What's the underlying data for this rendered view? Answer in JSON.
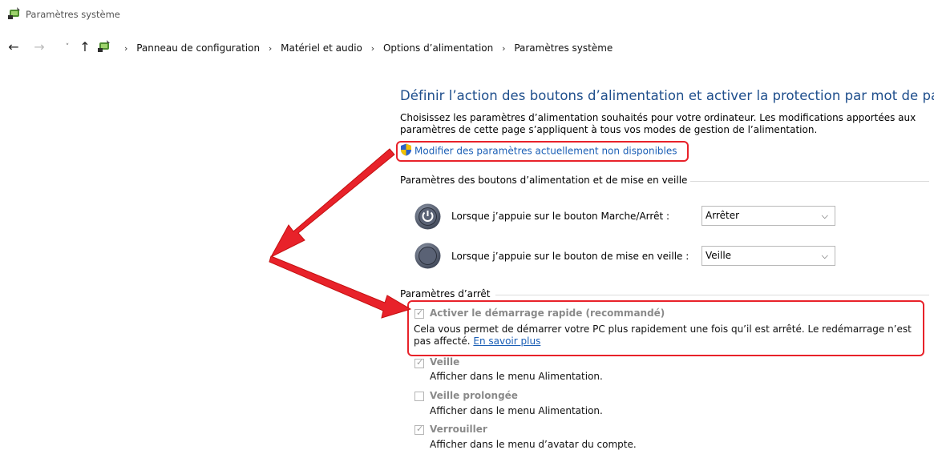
{
  "window": {
    "title": "Paramètres système",
    "icon": "power-options-icon"
  },
  "nav": {
    "back": "←",
    "forward": "→",
    "recent": "˅",
    "up": "↑",
    "breadcrumb": [
      "Panneau de configuration",
      "Matériel et audio",
      "Options d’alimentation",
      "Paramètres système"
    ]
  },
  "page": {
    "heading": "Définir l’action des boutons d’alimentation et activer la protection par mot de passe",
    "description": "Choisissez les paramètres d’alimentation souhaités pour votre ordinateur. Les modifications apportées aux paramètres de cette page s’appliquent à tous vos modes de gestion de l’alimentation.",
    "uac_link": "Modifier des paramètres actuellement non disponibles"
  },
  "buttons_group": {
    "label": "Paramètres des boutons d’alimentation et de mise en veille",
    "rows": [
      {
        "label": "Lorsque j’appuie sur le bouton Marche/Arrêt :",
        "value": "Arrêter",
        "icon": "power-button-icon"
      },
      {
        "label": "Lorsque j’appuie sur le bouton de mise en veille :",
        "value": "Veille",
        "icon": "sleep-button-icon"
      }
    ]
  },
  "shutdown_group": {
    "label": "Paramètres d’arrêt",
    "options": [
      {
        "title": "Activer le démarrage rapide (recommandé)",
        "checked": true,
        "desc": "Cela vous permet de démarrer votre PC plus rapidement une fois qu’il est arrêté. Le redémarrage n’est pas affecté.",
        "link": "En savoir plus"
      },
      {
        "title": "Veille",
        "checked": true,
        "desc": "Afficher dans le menu Alimentation."
      },
      {
        "title": "Veille prolongée",
        "checked": false,
        "desc": "Afficher dans le menu Alimentation."
      },
      {
        "title": "Verrouiller",
        "checked": true,
        "desc": "Afficher dans le menu d’avatar du compte."
      }
    ]
  },
  "colors": {
    "heading": "#1e4e8c",
    "link": "#1b5fb6",
    "annotation": "#e8222a"
  }
}
